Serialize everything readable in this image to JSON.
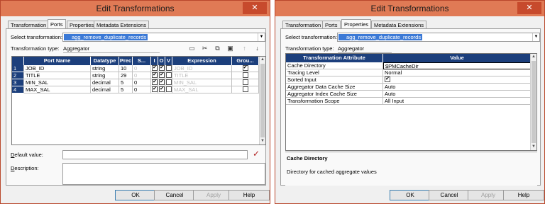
{
  "left_window": {
    "title": "Edit Transformations",
    "close": "✕",
    "tabs": [
      {
        "label": "Transformation",
        "active": false
      },
      {
        "label": "Ports",
        "active": true
      },
      {
        "label": "Properties",
        "active": false
      },
      {
        "label": "Metadata Extensions",
        "active": false
      }
    ],
    "select_label": "Select transformation:",
    "select_value": "agg_remove_duplicate_records",
    "type_label": "Transformation type:",
    "type_value": "Aggregator",
    "toolbar_icons": [
      "new-port-icon",
      "cut-icon",
      "copy-icon",
      "paste-icon",
      "move-up-icon",
      "move-down-icon"
    ],
    "ports_grid": {
      "headers": [
        "Port Name",
        "Datatype",
        "Prec",
        "S...",
        "I",
        "O",
        "V",
        "Expression",
        "Grou..."
      ],
      "rows": [
        {
          "num": "1",
          "name": "JOB_ID",
          "datatype": "string",
          "prec": "10",
          "scale": "0",
          "i": true,
          "o": true,
          "v": false,
          "expr": "JOB_ID",
          "group": true
        },
        {
          "num": "2",
          "name": "TITLE",
          "datatype": "string",
          "prec": "29",
          "scale": "0",
          "i": true,
          "o": true,
          "v": false,
          "expr": "TITLE",
          "group": false
        },
        {
          "num": "3",
          "name": "MIN_SAL",
          "datatype": "decimal",
          "prec": "5",
          "scale": "0",
          "i": true,
          "o": true,
          "v": false,
          "expr": "MIN_SAL",
          "group": false
        },
        {
          "num": "4",
          "name": "MAX_SAL",
          "datatype": "decimal",
          "prec": "5",
          "scale": "0",
          "i": true,
          "o": true,
          "v": false,
          "expr": "MAX_SAL",
          "group": false
        }
      ]
    },
    "default_value_label": "Default value:",
    "default_value": "",
    "description_label": "Description:",
    "description": "",
    "buttons": {
      "ok": "OK",
      "cancel": "Cancel",
      "apply": "Apply",
      "help": "Help"
    }
  },
  "right_window": {
    "title": "Edit Transformations",
    "close": "✕",
    "tabs": [
      {
        "label": "Transformation",
        "active": false
      },
      {
        "label": "Ports",
        "active": false
      },
      {
        "label": "Properties",
        "active": true
      },
      {
        "label": "Metadata Extensions",
        "active": false
      }
    ],
    "select_label": "Select transformation:",
    "select_value": "agg_remove_duplicate_records",
    "type_label": "Transformation type:",
    "type_value": "Aggregator",
    "properties_grid": {
      "headers": [
        "Transformation Attribute",
        "Value"
      ],
      "rows": [
        {
          "attr": "Cache Directory",
          "value": "$PMCacheDir",
          "checkbox": false
        },
        {
          "attr": "Tracing Level",
          "value": "Normal",
          "checkbox": false
        },
        {
          "attr": "Sorted Input",
          "value": "",
          "checkbox": true
        },
        {
          "attr": "Aggregator Data Cache Size",
          "value": "Auto",
          "checkbox": false
        },
        {
          "attr": "Aggregator Index Cache Size",
          "value": "Auto",
          "checkbox": false
        },
        {
          "attr": "Transformation Scope",
          "value": "All Input",
          "checkbox": false
        }
      ]
    },
    "description_title": "Cache Directory",
    "description_text": "Directory for cached aggregate values",
    "buttons": {
      "ok": "OK",
      "cancel": "Cancel",
      "apply": "Apply",
      "help": "Help"
    }
  }
}
